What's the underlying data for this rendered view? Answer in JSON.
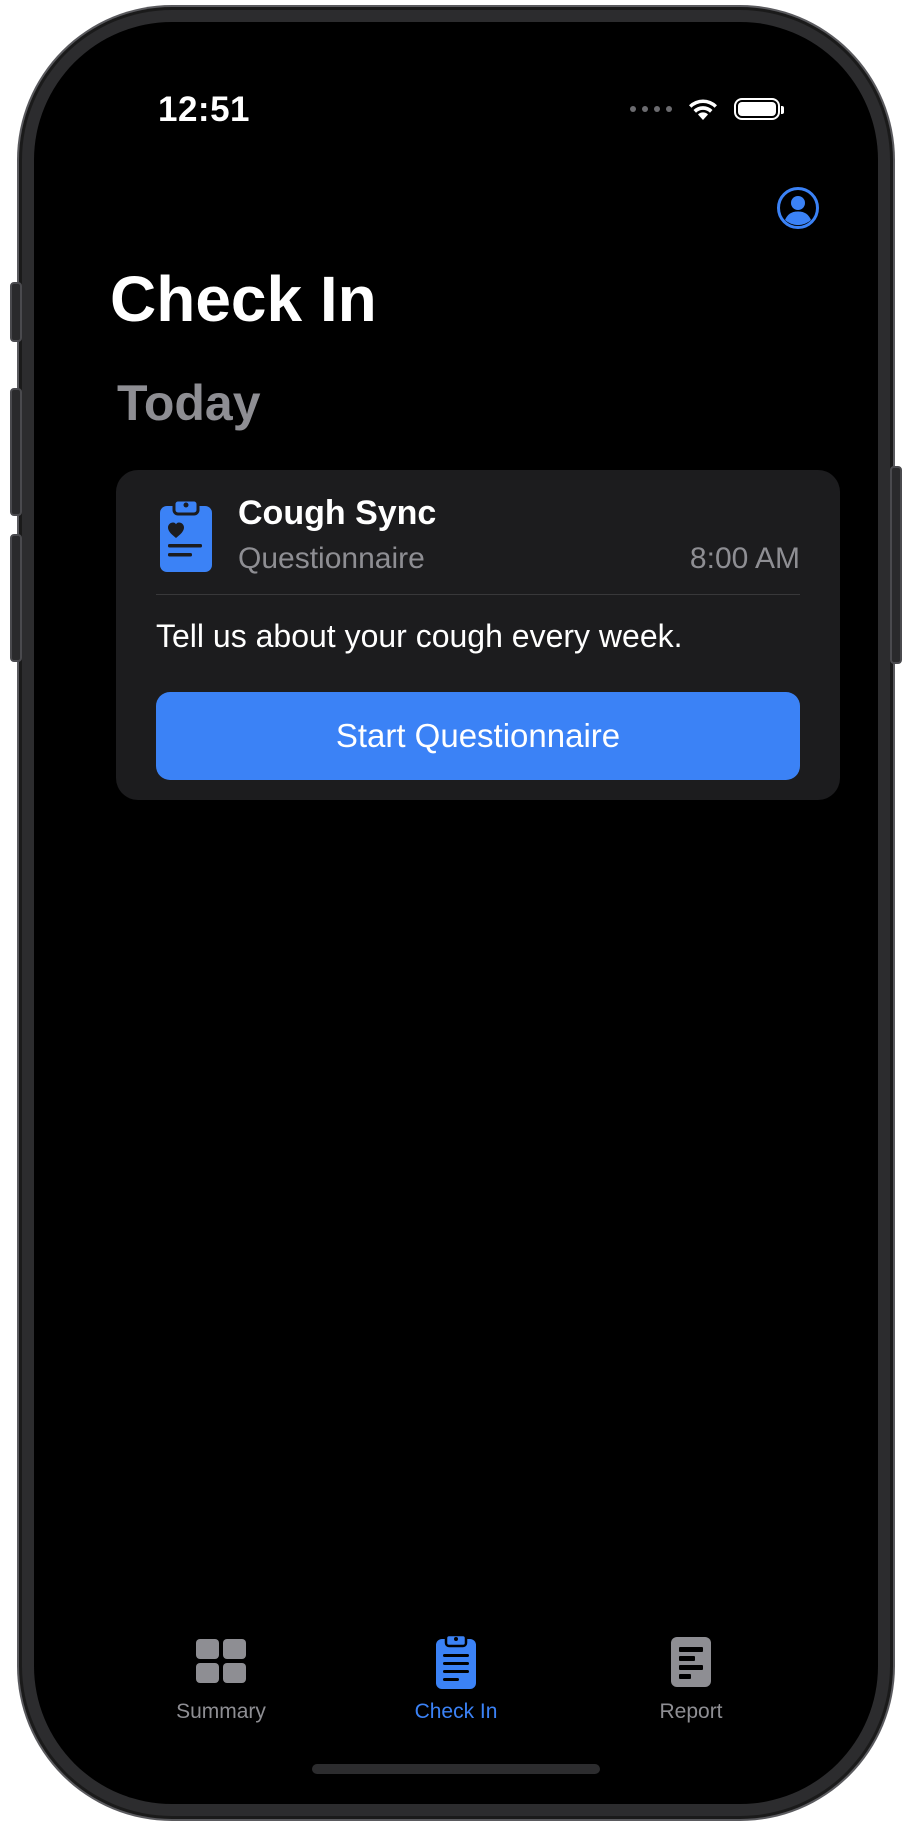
{
  "status_bar": {
    "time": "12:51"
  },
  "header": {
    "title": "Check In",
    "profile_icon": "person-circle-icon"
  },
  "section": {
    "title": "Today"
  },
  "task_card": {
    "icon": "clipboard-heart-icon",
    "title": "Cough Sync",
    "subtitle": "Questionnaire",
    "time": "8:00 AM",
    "description": "Tell us about your cough every week.",
    "button_label": "Start Questionnaire"
  },
  "tab_bar": {
    "tabs": [
      {
        "label": "Summary",
        "icon": "grid-icon",
        "active": false
      },
      {
        "label": "Check In",
        "icon": "clipboard-icon",
        "active": true
      },
      {
        "label": "Report",
        "icon": "document-icon",
        "active": false
      }
    ]
  },
  "colors": {
    "accent": "#3b82f6",
    "background": "#000000",
    "card": "#1c1c1e",
    "secondary_text": "#8e8e93"
  }
}
